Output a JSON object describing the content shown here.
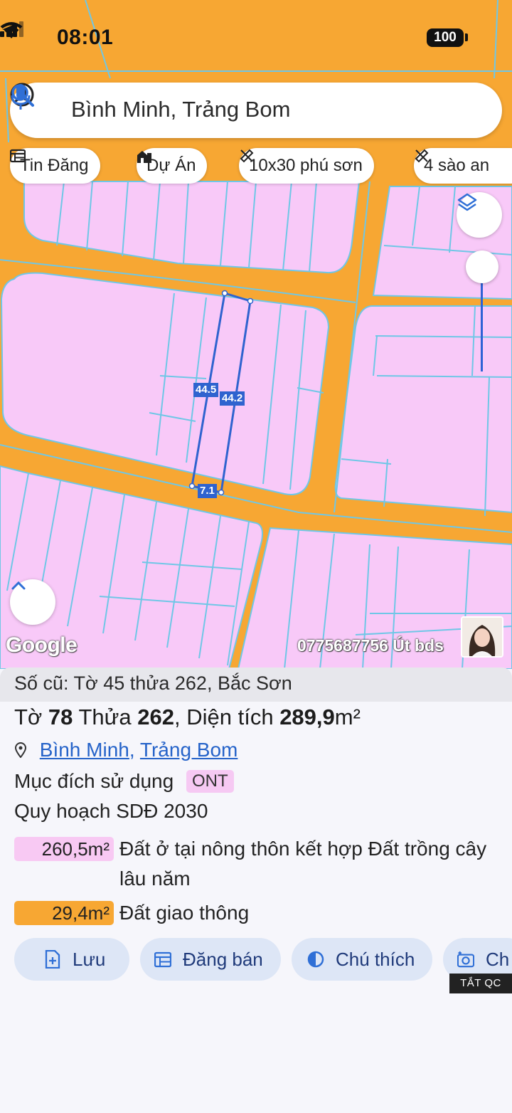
{
  "status_bar": {
    "time": "08:01",
    "battery": "100"
  },
  "search": {
    "query": "Bình Minh, Trảng Bom"
  },
  "chips": [
    {
      "label": "Tin Đăng",
      "icon": "listing-icon"
    },
    {
      "label": "Dự Án",
      "icon": "project-icon"
    },
    {
      "label": "10x30 phú sơn",
      "icon": "ruler-icon"
    },
    {
      "label": "4 sào an",
      "icon": "ruler-icon"
    }
  ],
  "map": {
    "attribution": "Google",
    "watermark": "0775687756 Út bds",
    "measurements": {
      "left_side": "44.5",
      "right_side": "44.2",
      "bottom_side": "7.1"
    },
    "colors": {
      "road": "#f7a733",
      "land": "#f8c9f8",
      "parcel_line": "#6fc7e6",
      "selection": "#2f63cf"
    }
  },
  "info": {
    "old_record": "Số cũ: Tờ 45 thửa 262, Bắc Sơn",
    "sheet_label": "Tờ",
    "sheet_no": "78",
    "parcel_label": "Thửa",
    "parcel_no": "262",
    "area_label": "Diện tích",
    "area_value": "289,9",
    "area_unit": "m²",
    "commune": "Bình Minh",
    "district": "Trảng Bom",
    "purpose_label": "Mục đích sử dụng",
    "purpose_code": "ONT",
    "planning_title": "Quy hoạch SDĐ 2030",
    "zones": [
      {
        "area": "260,5m²",
        "description": "Đất ở tại nông thôn kết hợp Đất trồng cây lâu năm",
        "color": "#f8c9f3"
      },
      {
        "area": "29,4m²",
        "description": "Đất giao thông",
        "color": "#f7a733"
      }
    ]
  },
  "actions": [
    {
      "label": "Lưu",
      "icon": "save-icon"
    },
    {
      "label": "Đăng bán",
      "icon": "post-icon"
    },
    {
      "label": "Chú thích",
      "icon": "legend-icon"
    },
    {
      "label": "Ch",
      "icon": "camera-icon"
    }
  ],
  "ad_tag": "TẮT QC"
}
